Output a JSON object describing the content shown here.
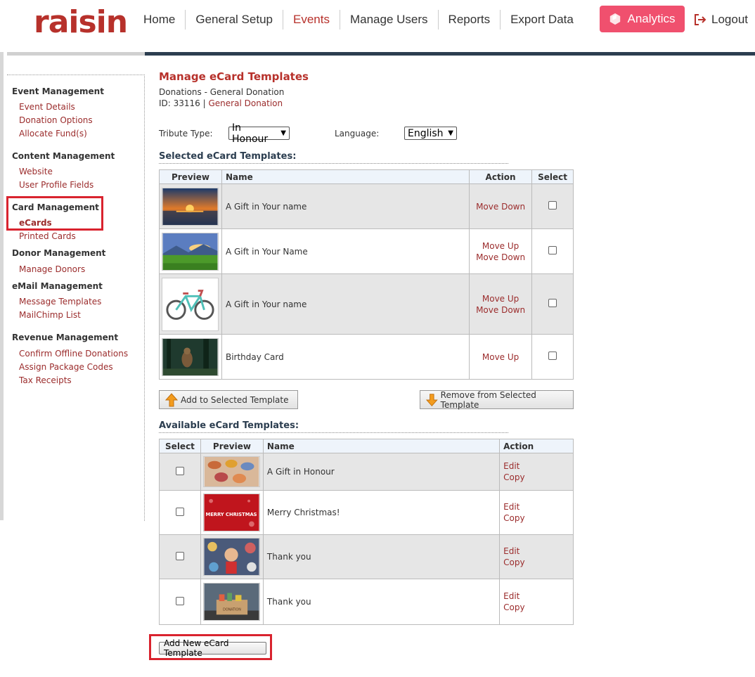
{
  "header": {
    "logo": "raisin",
    "nav": [
      "Home",
      "General Setup",
      "Events",
      "Manage Users",
      "Reports",
      "Export Data"
    ],
    "active_nav": "Events",
    "analytics_label": "Analytics",
    "logout_label": "Logout"
  },
  "colors": {
    "brand": "#b7312b",
    "analytics": "#f0506e",
    "header_bar": "#2c3e50",
    "highlight": "#d9232e"
  },
  "sidebar": {
    "sections": [
      {
        "title": "Event Management",
        "items": [
          "Event Details",
          "Donation Options",
          "Allocate Fund(s)"
        ]
      },
      {
        "title": "Content Management",
        "items": [
          "Website",
          "User Profile Fields"
        ]
      },
      {
        "title": "Card Management",
        "items": [
          "eCards",
          "Printed Cards"
        ]
      },
      {
        "title": "Donor Management",
        "items": [
          "Manage Donors"
        ]
      },
      {
        "title": "eMail Management",
        "items": [
          "Message Templates",
          "MailChimp List"
        ]
      },
      {
        "title": "Revenue Management",
        "items": [
          "Confirm Offline Donations",
          "Assign Package Codes",
          "Tax Receipts"
        ]
      }
    ],
    "active_item": "eCards"
  },
  "main": {
    "title": "Manage eCard Templates",
    "subtitle": "Donations - General Donation",
    "id_prefix": "ID: 33116 |",
    "id_link": "General Donation",
    "tribute_label": "Tribute Type:",
    "tribute_value": "In Honour",
    "language_label": "Language:",
    "language_value": "English",
    "selected_title": "Selected eCard Templates:",
    "selected_headers": [
      "Preview",
      "Name",
      "Action",
      "Select"
    ],
    "selected_rows": [
      {
        "name": "A Gift in Your name",
        "actions": [
          "Move Down"
        ],
        "thumb": "sunset"
      },
      {
        "name": "A Gift in Your Name",
        "actions": [
          "Move Up",
          "Move Down"
        ],
        "thumb": "meadow"
      },
      {
        "name": "A Gift in Your name",
        "actions": [
          "Move Up",
          "Move Down"
        ],
        "thumb": "bicycle"
      },
      {
        "name": "Birthday Card",
        "actions": [
          "Move Up"
        ],
        "thumb": "forest-dog"
      }
    ],
    "add_button": "Add to Selected Template",
    "remove_button": "Remove from Selected Template",
    "available_title": "Available eCard Templates:",
    "available_headers": [
      "Select",
      "Preview",
      "Name",
      "Action"
    ],
    "available_rows": [
      {
        "name": "A Gift in Honour",
        "actions": [
          "Edit",
          "Copy"
        ],
        "thumb": "shoes"
      },
      {
        "name": "Merry Christmas!",
        "actions": [
          "Edit",
          "Copy"
        ],
        "thumb": "christmas"
      },
      {
        "name": "Thank you",
        "actions": [
          "Edit",
          "Copy"
        ],
        "thumb": "child"
      },
      {
        "name": "Thank you",
        "actions": [
          "Edit",
          "Copy"
        ],
        "thumb": "donation-box"
      }
    ],
    "xmas_thumb_text": "MERRY CHRISTMAS",
    "donation_thumb_text": "DONATION",
    "add_new_button": "Add New eCard Template"
  }
}
